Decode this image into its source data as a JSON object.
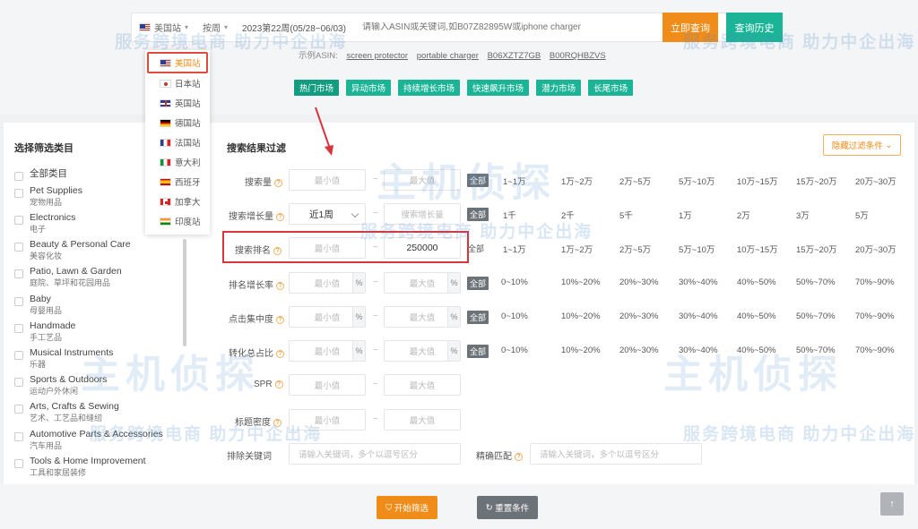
{
  "search": {
    "site": "美国站",
    "category": "按周",
    "period": "2023第22周(05/28~06/03)",
    "placeholder": "请输入ASIN或关键词,如B07Z82895W或iphone charger",
    "search_button": "立即查询",
    "history_button": "查询历史",
    "examples_label": "示例ASIN:",
    "examples": [
      "screen protector",
      "portable charger",
      "B06XZTZ7GB",
      "B00RQHBZVS"
    ]
  },
  "markets": [
    "热门市场",
    "异动市场",
    "持续增长市场",
    "快速飙升市场",
    "潜力市场",
    "长尾市场"
  ],
  "sites": [
    {
      "label": "美国站",
      "flag": "us"
    },
    {
      "label": "日本站",
      "flag": "jp"
    },
    {
      "label": "英国站",
      "flag": "uk"
    },
    {
      "label": "德国站",
      "flag": "de"
    },
    {
      "label": "法国站",
      "flag": "fr"
    },
    {
      "label": "意大利",
      "flag": "it"
    },
    {
      "label": "西班牙",
      "flag": "es"
    },
    {
      "label": "加拿大",
      "flag": "ca"
    },
    {
      "label": "印度站",
      "flag": "in"
    }
  ],
  "sidebar": {
    "title": "选择筛选类目",
    "categories": [
      {
        "en": "全部类目",
        "zh": ""
      },
      {
        "en": "Pet Supplies",
        "zh": "宠物用品"
      },
      {
        "en": "Electronics",
        "zh": "电子"
      },
      {
        "en": "Beauty & Personal Care",
        "zh": "美容化妆"
      },
      {
        "en": "Patio, Lawn & Garden",
        "zh": "庭院、草坪和花园用品"
      },
      {
        "en": "Baby",
        "zh": "母婴用品"
      },
      {
        "en": "Handmade",
        "zh": "手工艺品"
      },
      {
        "en": "Musical Instruments",
        "zh": "乐器"
      },
      {
        "en": "Sports & Outdoors",
        "zh": "运动户外休闲"
      },
      {
        "en": "Arts, Crafts & Sewing",
        "zh": "艺术、工艺品和缝纫"
      },
      {
        "en": "Automotive Parts & Accessories",
        "zh": "汽车用品"
      },
      {
        "en": "Tools & Home Improvement",
        "zh": "工具和家居装修"
      }
    ]
  },
  "filters": {
    "title": "搜索结果过滤",
    "collapse_button": "隐藏过滤条件",
    "min_placeholder": "最小值",
    "max_placeholder": "最大值",
    "all_label": "全部",
    "rows": {
      "search_volume": {
        "label": "搜索量",
        "options": [
          "1~1万",
          "1万~2万",
          "2万~5万",
          "5万~10万",
          "10万~15万",
          "15万~20万",
          "20万~30万"
        ]
      },
      "volume_growth": {
        "label": "搜索增长量",
        "period": "近1周",
        "options": [
          "1千",
          "2千",
          "5千",
          "1万",
          "2万",
          "3万",
          "5万"
        ]
      },
      "search_rank": {
        "label": "搜索排名",
        "max_value": "250000",
        "options": [
          "1~1万",
          "1万~2万",
          "2万~5万",
          "5万~10万",
          "10万~15万",
          "15万~20万",
          "20万~30万"
        ]
      },
      "rank_growth": {
        "label": "排名增长率",
        "options": [
          "0~10%",
          "10%~20%",
          "20%~30%",
          "30%~40%",
          "40%~50%",
          "50%~70%",
          "70%~90%"
        ]
      },
      "click_concentration": {
        "label": "点击集中度",
        "options": [
          "0~10%",
          "10%~20%",
          "20%~30%",
          "30%~40%",
          "40%~50%",
          "50%~70%",
          "70%~90%"
        ]
      },
      "conversion_share": {
        "label": "转化总占比",
        "options": [
          "0~10%",
          "10%~20%",
          "20%~30%",
          "30%~40%",
          "40%~50%",
          "50%~70%",
          "70%~90%"
        ]
      },
      "spr": {
        "label": "SPR"
      },
      "title_density": {
        "label": "标题密度"
      }
    },
    "exclude_label": "排除关键词",
    "exclude_placeholder": "请输入关键词，多个以逗号区分",
    "exact_label": "精确匹配",
    "exact_placeholder": "请输入关键词，多个以逗号区分"
  },
  "actions": {
    "start": "开始筛选",
    "reset": "重置条件"
  },
  "watermark": {
    "brand": "主机侦探",
    "slogan": "服务跨境电商 助力中企出海"
  },
  "colors": {
    "orange": "#f08c1a",
    "teal": "#1cb496",
    "highlight": "#d9343a"
  }
}
